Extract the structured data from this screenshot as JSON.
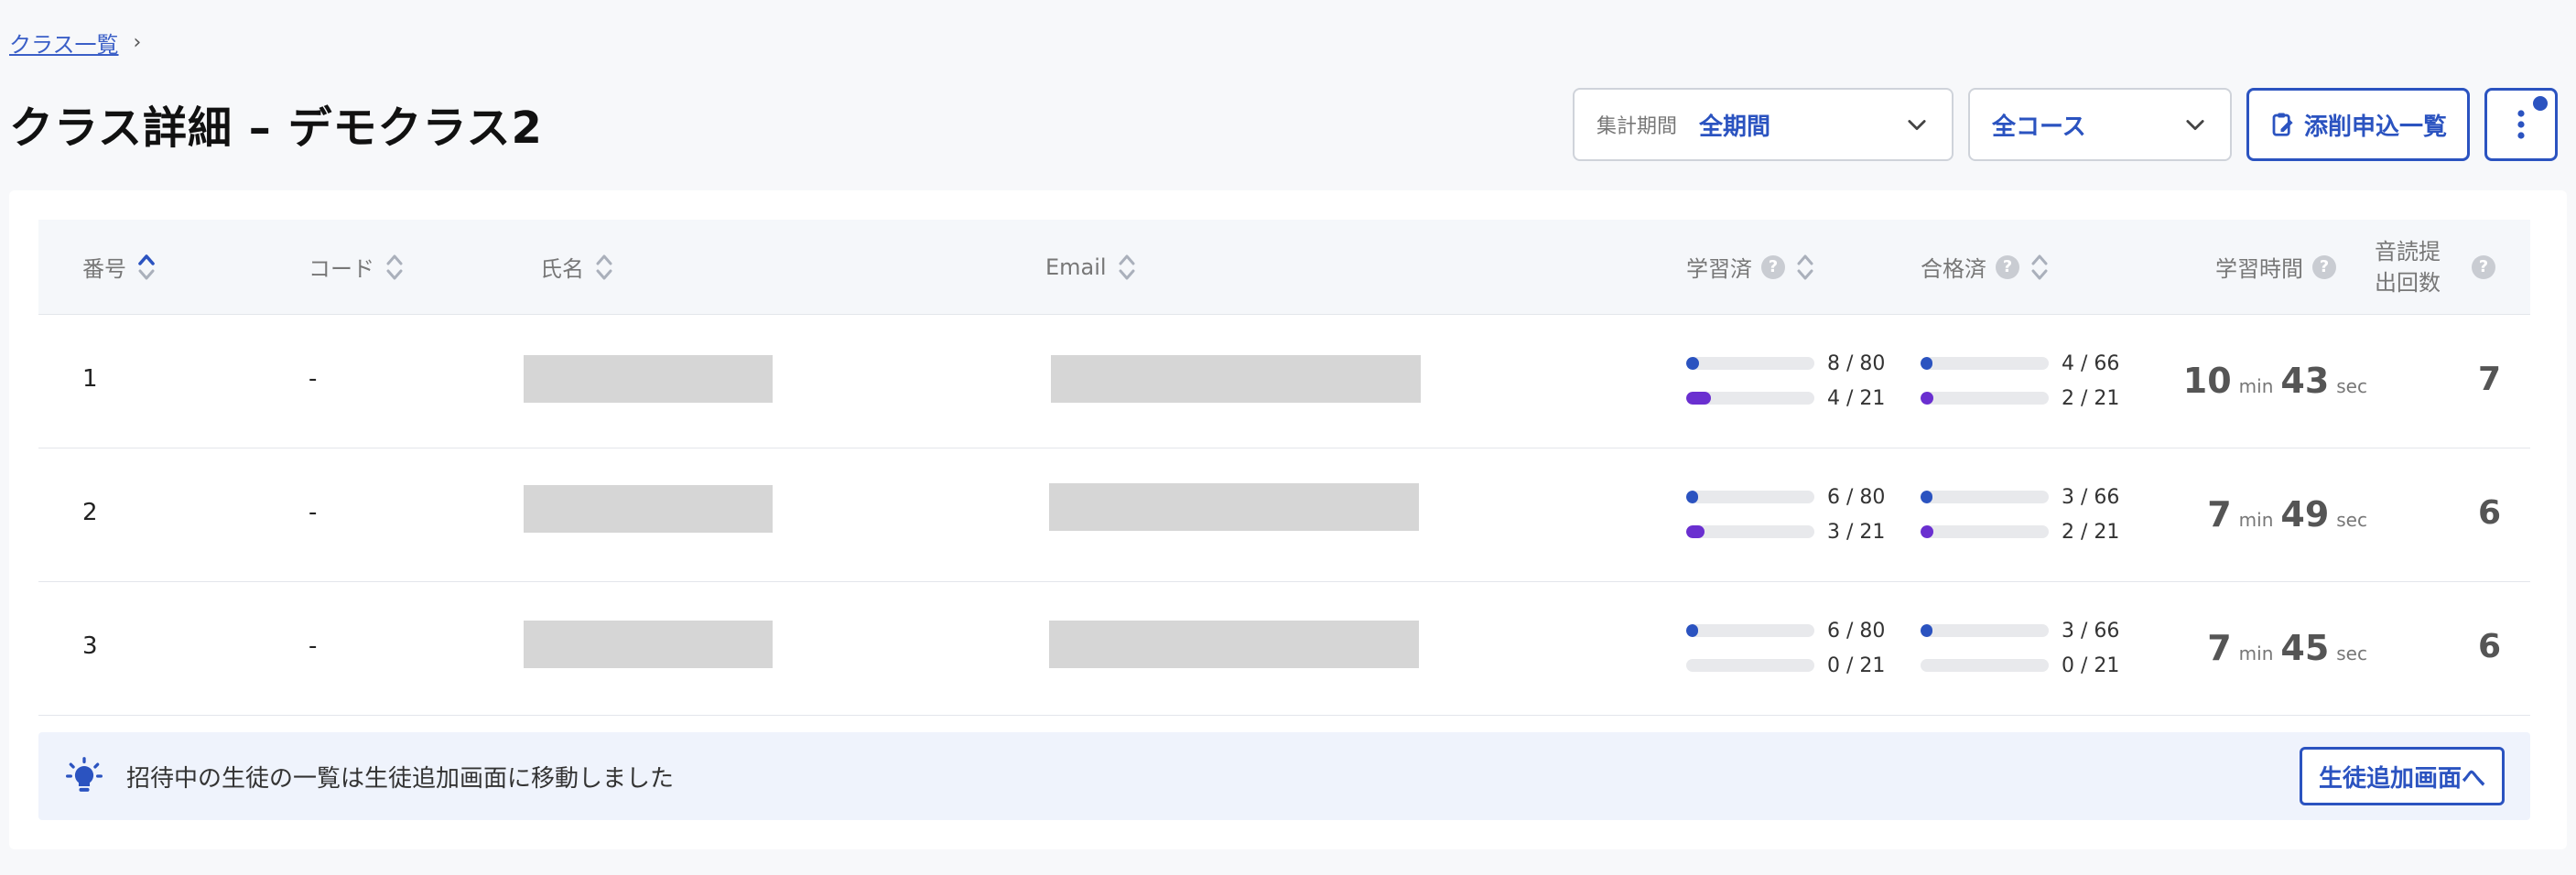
{
  "breadcrumb": {
    "link": "クラス一覧",
    "sep": "›"
  },
  "page_title": "クラス詳細 – デモクラス2",
  "filters": {
    "period_label": "集計期間",
    "period_value": "全期間",
    "course_value": "全コース",
    "correction_button": "添削申込一覧"
  },
  "table": {
    "headers": {
      "number": "番号",
      "code": "コード",
      "name": "氏名",
      "email": "Email",
      "studied": "学習済",
      "passed": "合格済",
      "study_time": "学習時間",
      "reading_count_1": "音読提",
      "reading_count_2": "出回数"
    },
    "units": {
      "min": "min",
      "sec": "sec"
    },
    "rows": [
      {
        "number": "1",
        "code": "-",
        "studied_a": "8 / 80",
        "studied_b": "4 / 21",
        "passed_a": "4 / 66",
        "passed_b": "2 / 21",
        "studied_a_frac": 0.1,
        "studied_b_frac": 0.19,
        "passed_a_frac": 0.06,
        "passed_b_frac": 0.1,
        "min": "10",
        "sec": "43",
        "reading": "7"
      },
      {
        "number": "2",
        "code": "-",
        "studied_a": "6 / 80",
        "studied_b": "3 / 21",
        "passed_a": "3 / 66",
        "passed_b": "2 / 21",
        "studied_a_frac": 0.075,
        "studied_b_frac": 0.14,
        "passed_a_frac": 0.045,
        "passed_b_frac": 0.1,
        "min": "7",
        "sec": "49",
        "reading": "6"
      },
      {
        "number": "3",
        "code": "-",
        "studied_a": "6 / 80",
        "studied_b": "0 / 21",
        "passed_a": "3 / 66",
        "passed_b": "0 / 21",
        "studied_a_frac": 0.075,
        "studied_b_frac": 0,
        "passed_a_frac": 0.045,
        "passed_b_frac": 0,
        "min": "7",
        "sec": "45",
        "reading": "6"
      }
    ]
  },
  "notice": {
    "text": "招待中の生徒の一覧は生徒追加画面に移動しました",
    "button": "生徒追加画面へ"
  },
  "colors": {
    "accent": "#2b53c0",
    "bar_blue": "#2b53c0",
    "bar_purple": "#6a2fd0"
  }
}
